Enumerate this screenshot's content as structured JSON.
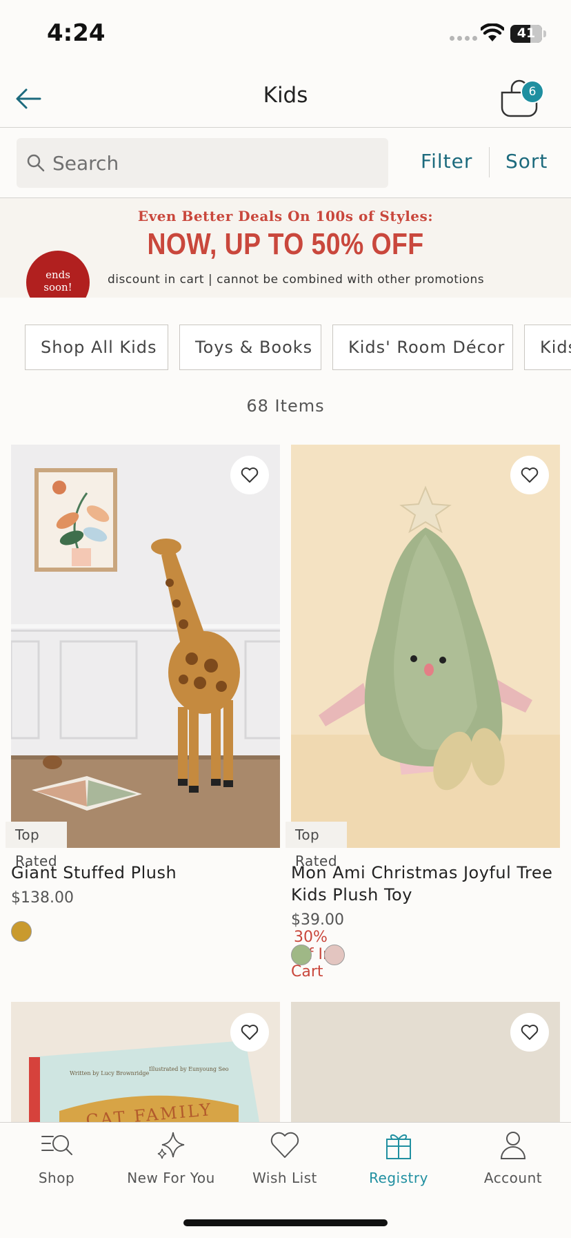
{
  "status_bar": {
    "time": "4:24",
    "battery": "41"
  },
  "header": {
    "title": "Kids",
    "cart_count": "6"
  },
  "search": {
    "placeholder": "Search",
    "filter_label": "Filter",
    "sort_label": "Sort"
  },
  "promo": {
    "subheadline": "Even Better Deals On 100s of Styles:",
    "headline": "NOW, UP TO 50% OFF",
    "note": "discount in cart | cannot be combined with other promotions",
    "badge_line1": "ends",
    "badge_line2": "soon!"
  },
  "categories": [
    {
      "label": "Shop All Kids"
    },
    {
      "label": "Toys & Books"
    },
    {
      "label": "Kids' Room Décor"
    },
    {
      "label": "Kids"
    }
  ],
  "item_count": "68 Items",
  "products": [
    {
      "badge": "Top Rated",
      "name": "Giant Stuffed Plush",
      "price": "$138.00",
      "promo": "",
      "swatches": [
        "#c99a2e"
      ]
    },
    {
      "badge": "Top Rated",
      "name": "Mon Ami Christmas Joyful Tree Kids Plush Toy",
      "price": "$39.00",
      "promo": "30% Off In Cart",
      "swatches": [
        "#9fb886",
        "#e3c5c0"
      ]
    },
    {
      "book_title": "CAT FAMILY",
      "book_author": "Written by Lucy Brownridge",
      "book_illustrator": "Illustrated by Eunyoung Seo"
    },
    {}
  ],
  "tabs": [
    {
      "label": "Shop",
      "icon": "shop-search-icon"
    },
    {
      "label": "New For You",
      "icon": "sparkle-icon"
    },
    {
      "label": "Wish List",
      "icon": "heart-icon"
    },
    {
      "label": "Registry",
      "icon": "gift-icon",
      "active": true
    },
    {
      "label": "Account",
      "icon": "person-icon"
    }
  ],
  "colors": {
    "accent": "#1f8fa0",
    "link": "#1c6a7d",
    "sale": "#c9473c"
  }
}
